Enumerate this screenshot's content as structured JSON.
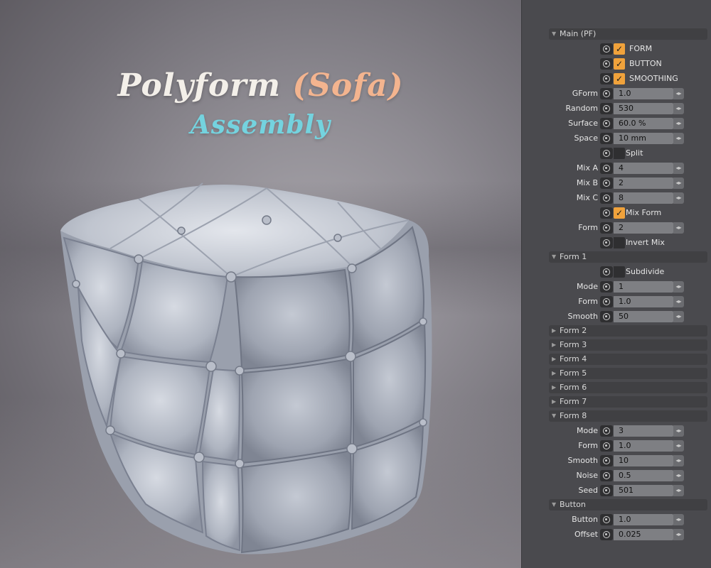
{
  "viewport": {
    "title_part1": "Polyform ",
    "title_part2": "(Sofa)",
    "subtitle": "Assembly"
  },
  "panel": {
    "sections": [
      {
        "id": "main",
        "label": "Main (PF)",
        "expanded": true
      },
      {
        "id": "form1",
        "label": "Form 1",
        "expanded": true
      },
      {
        "id": "form2",
        "label": "Form 2",
        "expanded": false
      },
      {
        "id": "form3",
        "label": "Form 3",
        "expanded": false
      },
      {
        "id": "form4",
        "label": "Form 4",
        "expanded": false
      },
      {
        "id": "form5",
        "label": "Form 5",
        "expanded": false
      },
      {
        "id": "form6",
        "label": "Form 6",
        "expanded": false
      },
      {
        "id": "form7",
        "label": "Form 7",
        "expanded": false
      },
      {
        "id": "form8",
        "label": "Form 8",
        "expanded": true
      },
      {
        "id": "button",
        "label": "Button",
        "expanded": true
      }
    ],
    "main": {
      "form_check": {
        "label": "FORM",
        "checked": true
      },
      "button_check": {
        "label": "BUTTON",
        "checked": true
      },
      "smoothing_check": {
        "label": "SMOOTHING",
        "checked": true
      },
      "gform": {
        "label": "GForm",
        "value": "1.0"
      },
      "random": {
        "label": "Random",
        "value": "530"
      },
      "surface": {
        "label": "Surface",
        "value": "60.0 %"
      },
      "space": {
        "label": "Space",
        "value": "10 mm"
      },
      "split": {
        "label": "Split",
        "checked": false
      },
      "mix_a": {
        "label": "Mix A",
        "value": "4"
      },
      "mix_b": {
        "label": "Mix B",
        "value": "2"
      },
      "mix_c": {
        "label": "Mix C",
        "value": "8"
      },
      "mix_form": {
        "label": "Mix Form",
        "checked": true
      },
      "form": {
        "label": "Form",
        "value": "2"
      },
      "invert_mix": {
        "label": "Invert Mix",
        "checked": false
      }
    },
    "form1": {
      "subdivide": {
        "label": "Subdivide",
        "checked": false
      },
      "mode": {
        "label": "Mode",
        "value": "1"
      },
      "form": {
        "label": "Form",
        "value": "1.0"
      },
      "smooth": {
        "label": "Smooth",
        "value": "50"
      }
    },
    "form8": {
      "mode": {
        "label": "Mode",
        "value": "3"
      },
      "form": {
        "label": "Form",
        "value": "1.0"
      },
      "smooth": {
        "label": "Smooth",
        "value": "10"
      },
      "noise": {
        "label": "Noise",
        "value": "0.5"
      },
      "seed": {
        "label": "Seed",
        "value": "501"
      }
    },
    "button": {
      "button": {
        "label": "Button",
        "value": "1.0"
      },
      "offset": {
        "label": "Offset",
        "value": "0.025"
      }
    },
    "colors": {
      "check": "#f0a23b",
      "panel": "#4a4a4e",
      "field": "#7e7f83",
      "subtitle": "#74d3df",
      "title_accent": "#f3b48f"
    },
    "icons": {
      "toggle": "reset-circle-icon",
      "spinner": "spinner-arrows-icon",
      "checkmark": "check-icon",
      "expand": "triangle-icon"
    }
  }
}
